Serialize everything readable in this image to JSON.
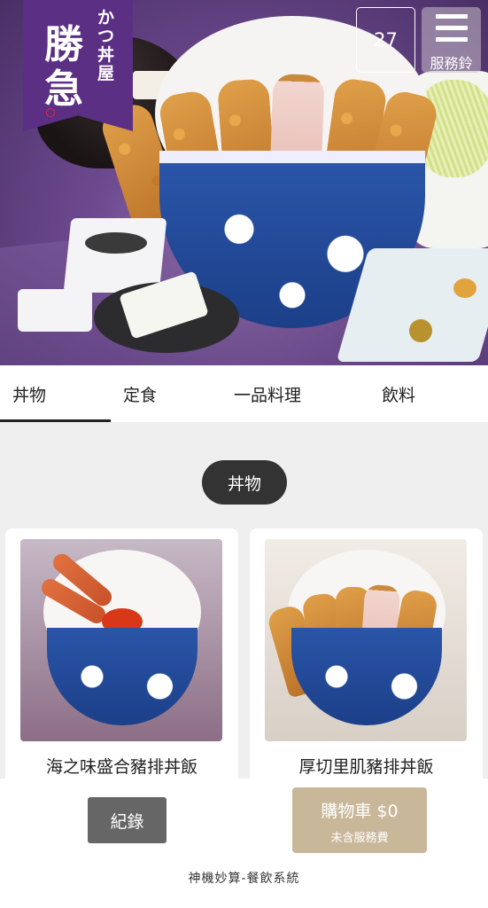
{
  "hero": {
    "logo_main": "勝急",
    "logo_side": "かつ丼屋",
    "table_number": "27",
    "service_label": "服務鈴",
    "service_icon": "hamburger-icon"
  },
  "tabs": [
    {
      "label": "丼物",
      "active": true
    },
    {
      "label": "定食",
      "active": false
    },
    {
      "label": "一品料理",
      "active": false
    },
    {
      "label": "飲料",
      "active": false
    }
  ],
  "section": {
    "title": "丼物"
  },
  "products": [
    {
      "name": "海之味盛合豬排丼飯"
    },
    {
      "name": "厚切里肌豬排丼飯"
    }
  ],
  "bottom": {
    "history_label": "紀錄",
    "cart_label": "購物車 $0",
    "cart_sub": "未含服務費",
    "footer": "神機妙算-餐飲系統"
  },
  "colors": {
    "accent": "#c9b79a",
    "dark_pill": "#333333",
    "history_button": "#666666",
    "brand_purple": "#5b2f84"
  }
}
